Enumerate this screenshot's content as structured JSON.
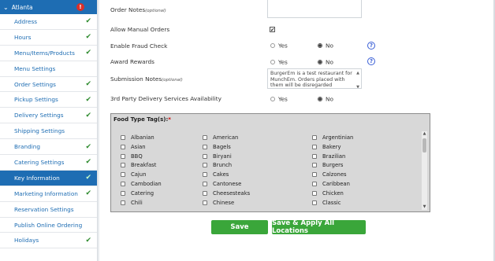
{
  "sidebar": {
    "location": "Atlanta",
    "alert_badge": "!",
    "items": [
      {
        "label": "Address",
        "check": "✔",
        "active": false
      },
      {
        "label": "Hours",
        "check": "✔",
        "active": false
      },
      {
        "label": "Menu/Items/Products",
        "check": "✔",
        "active": false
      },
      {
        "label": "Menu Settings",
        "check": "",
        "active": false
      },
      {
        "label": "Order Settings",
        "check": "✔",
        "active": false
      },
      {
        "label": "Pickup Settings",
        "check": "✔",
        "active": false
      },
      {
        "label": "Delivery Settings",
        "check": "✔",
        "active": false
      },
      {
        "label": "Shipping Settings",
        "check": "",
        "active": false
      },
      {
        "label": "Branding",
        "check": "✔",
        "active": false
      },
      {
        "label": "Catering Settings",
        "check": "✔",
        "active": false
      },
      {
        "label": "Key Information",
        "check": "✔",
        "active": true
      },
      {
        "label": "Marketing Information",
        "check": "✔",
        "active": false
      },
      {
        "label": "Reservation Settings",
        "check": "",
        "active": false
      },
      {
        "label": "Publish Online Ordering",
        "check": "",
        "active": false
      },
      {
        "label": "Holidays",
        "check": "✔",
        "active": false
      }
    ]
  },
  "form": {
    "order_notes_label": "Order Notes",
    "optional": "(optional)",
    "allow_manual_orders_label": "Allow Manual Orders",
    "allow_manual_orders_mark": "✔",
    "fraud_check_label": "Enable Fraud Check",
    "award_rewards_label": "Award Rewards",
    "submission_notes_label": "Submission Notes",
    "submission_notes_value": "BurgerEm is a test restaurant for MunchEm. Orders placed with them will be disregarded",
    "third_party_label": "3rd Party Delivery Services Availability",
    "yes": "Yes",
    "no": "No",
    "help": "?"
  },
  "food_types": {
    "title": "Food Type Tag(s):",
    "required_mark": "*",
    "columns": [
      [
        "Albanian",
        "Asian",
        "BBQ",
        "Breakfast",
        "Cajun",
        "Cambodian",
        "Catering",
        "Chili"
      ],
      [
        "American",
        "Bagels",
        "Biryani",
        "Brunch",
        "Cakes",
        "Cantonese",
        "Cheesesteaks",
        "Chinese"
      ],
      [
        "Argentinian",
        "Bakery",
        "Brazilian",
        "Burgers",
        "Calzones",
        "Caribbean",
        "Chicken",
        "Classic"
      ]
    ]
  },
  "buttons": {
    "save": "Save",
    "save_apply_all": "Save & Apply All Locations"
  },
  "colors": {
    "accent": "#1e6db3",
    "success": "#3aa63a",
    "alert": "#d9302a"
  }
}
